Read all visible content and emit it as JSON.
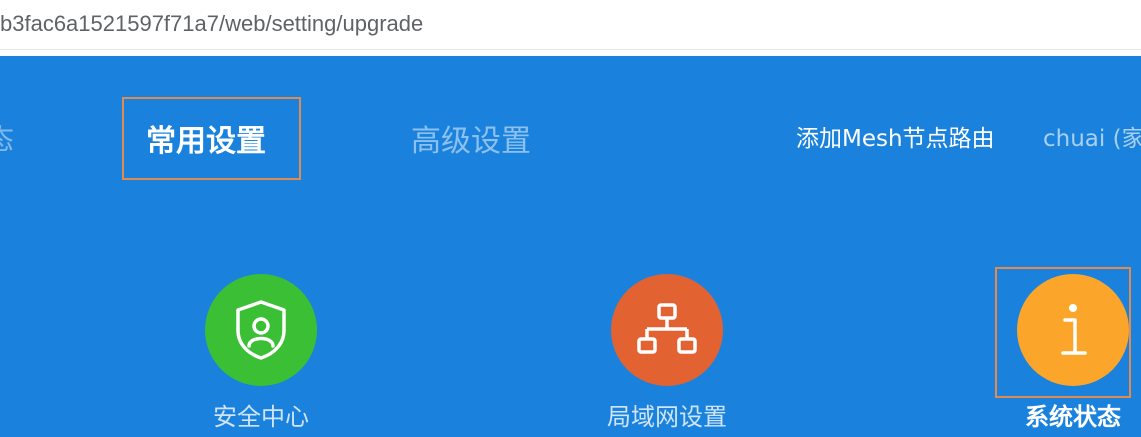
{
  "browser": {
    "url": "b3fac6a1521597f71a7/web/setting/upgrade"
  },
  "nav": {
    "partial_left": "态",
    "tabs": [
      {
        "label": "常用设置",
        "active": true
      },
      {
        "label": "高级设置",
        "active": false
      }
    ],
    "add_mesh": "添加Mesh节点路由",
    "user": "chuai (家"
  },
  "tiles": [
    {
      "label": "安全中心",
      "icon": "shield-user-icon",
      "color": "#3bbf35"
    },
    {
      "label": "局域网设置",
      "icon": "network-topology-icon",
      "color": "#e26232"
    },
    {
      "label": "系统状态",
      "icon": "info-icon",
      "color": "#fba62b",
      "selected": true
    }
  ],
  "colors": {
    "header_bg": "#1a82dd",
    "highlight": "#e28b4e"
  }
}
